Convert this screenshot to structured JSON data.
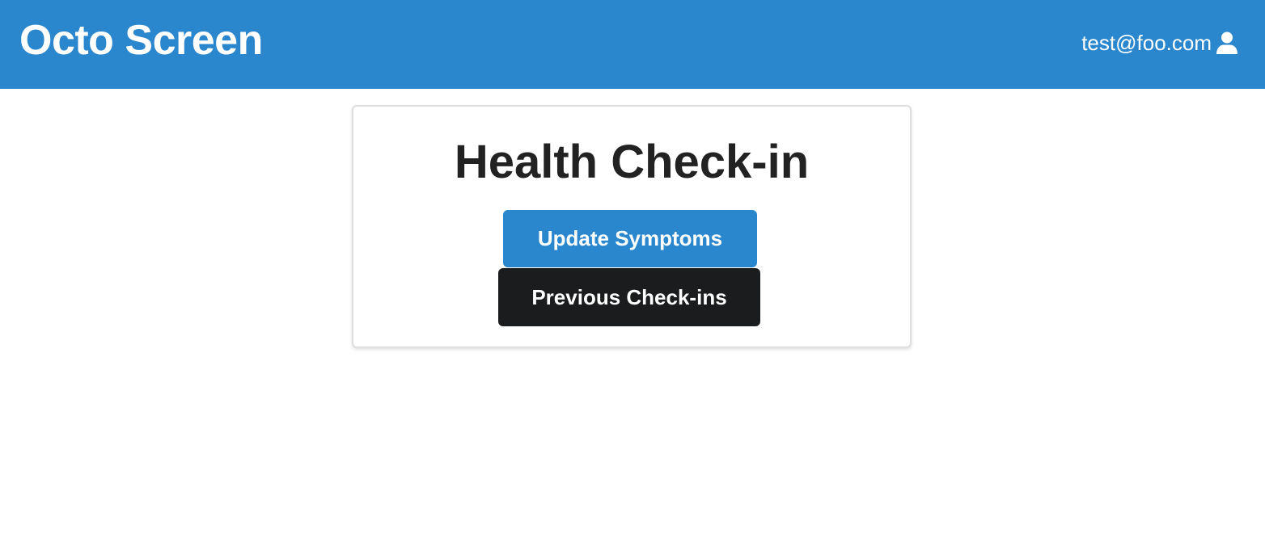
{
  "header": {
    "brand": "Octo Screen",
    "user_email": "test@foo.com",
    "user_icon": "user-icon"
  },
  "main": {
    "title": "Health Check-in",
    "update_symptoms_label": "Update Symptoms",
    "previous_checkins_label": "Previous Check-ins"
  },
  "colors": {
    "primary": "#2a87ce",
    "dark_button": "#1b1c1d",
    "title_text": "#222222",
    "header_text": "#ffffff"
  }
}
